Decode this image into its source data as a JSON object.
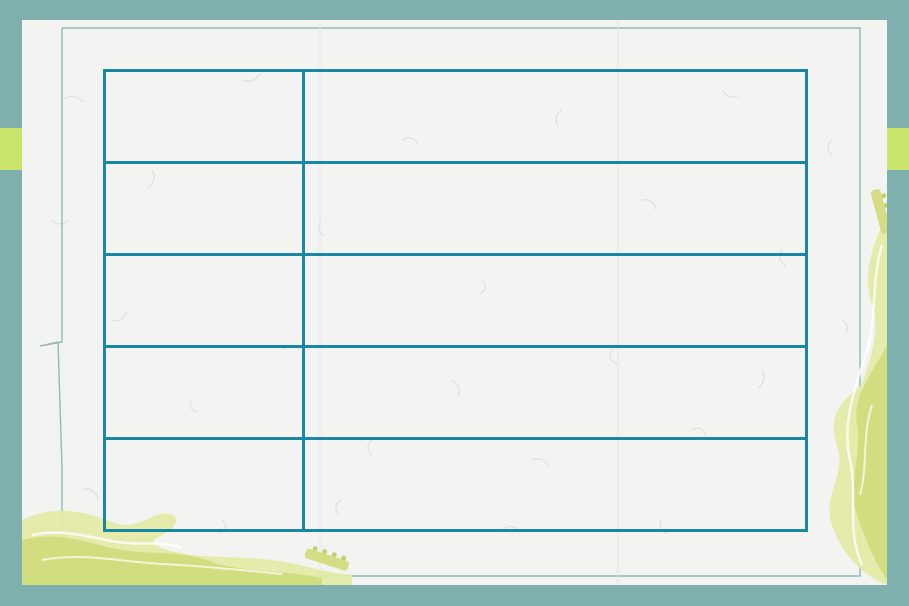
{
  "colors": {
    "outer_background": "#7fb0ad",
    "accent_tab": "#c8e46a",
    "paper": "#f3f4f2",
    "table_border": "#1a86a6",
    "frame_line": "#8fbcb8",
    "flame_light": "#dfe69a",
    "flame_mid": "#cfdc7a"
  },
  "icons": [
    "guitar-flame-decoration-left",
    "guitar-flame-decoration-right"
  ],
  "table": {
    "rows": [
      {
        "label": "",
        "value": ""
      },
      {
        "label": "",
        "value": ""
      },
      {
        "label": "",
        "value": ""
      },
      {
        "label": "",
        "value": ""
      },
      {
        "label": "",
        "value": ""
      }
    ]
  }
}
